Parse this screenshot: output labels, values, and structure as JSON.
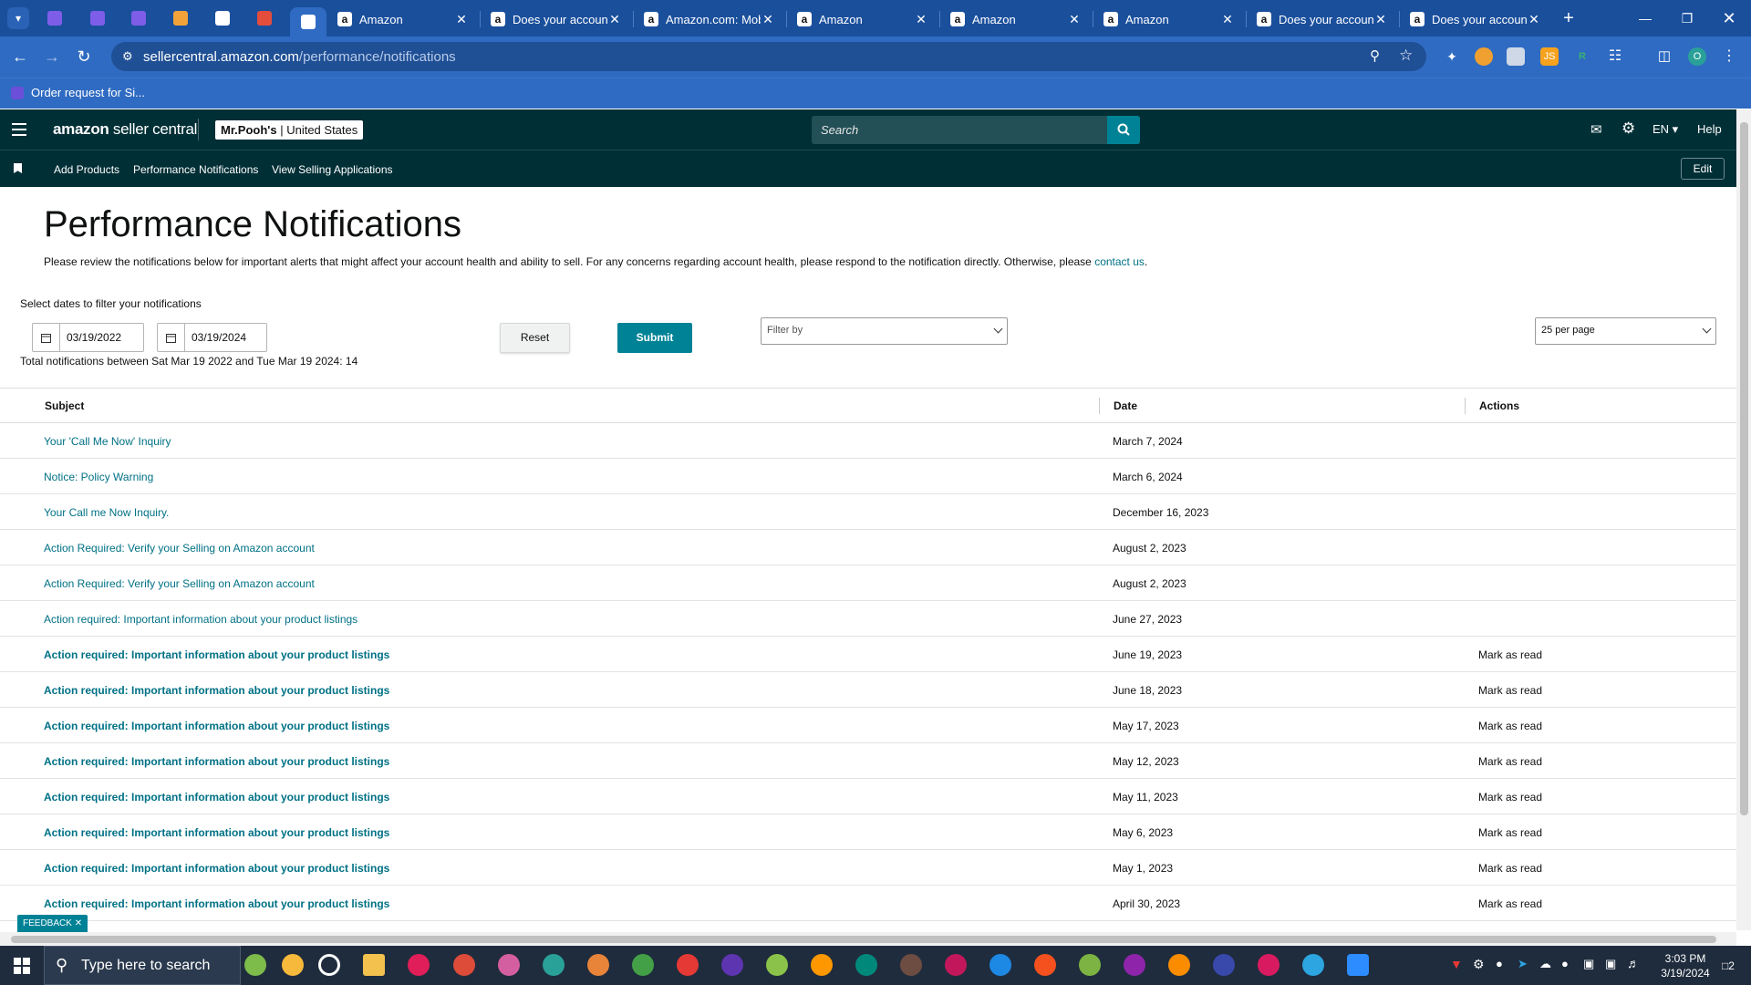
{
  "browser": {
    "tabs": [
      {
        "title": "Amazon",
        "favicon": "a"
      },
      {
        "title": "Does your account",
        "favicon": "a"
      },
      {
        "title": "Amazon.com: Mobile",
        "favicon": "a"
      },
      {
        "title": "Amazon",
        "favicon": "a"
      },
      {
        "title": "Amazon",
        "favicon": "a"
      },
      {
        "title": "Amazon",
        "favicon": "a"
      },
      {
        "title": "Does your account",
        "favicon": "a"
      },
      {
        "title": "Does your account",
        "favicon": "a"
      }
    ],
    "url_domain": "sellercentral.amazon.com",
    "url_path": "/performance/notifications",
    "bookmark": "Order request for Si..."
  },
  "header": {
    "logo_bold": "amazon",
    "logo_rest": " seller central",
    "store_name": "Mr.Pooh's",
    "store_region": " | United States",
    "search_placeholder": "Search",
    "language": "EN",
    "help": "Help"
  },
  "subnav": {
    "items": [
      "Add Products",
      "Performance Notifications",
      "View Selling Applications"
    ],
    "edit": "Edit"
  },
  "page": {
    "title": "Performance Notifications",
    "desc_text": "Please review the notifications below for important alerts that might affect your account health and ability to sell. For any concerns regarding account health, please respond to the notification directly. Otherwise, please ",
    "desc_link": "contact us",
    "desc_end": ".",
    "filter_label": "Select dates to filter your notifications",
    "date_from": "03/19/2022",
    "date_to": "03/19/2024",
    "reset": "Reset",
    "submit": "Submit",
    "filter_by": "Filter by",
    "per_page": "25 per page",
    "total": "Total notifications between Sat Mar 19 2022 and Tue Mar 19 2024: 14"
  },
  "table": {
    "headers": {
      "subject": "Subject",
      "date": "Date",
      "actions": "Actions"
    },
    "rows": [
      {
        "subject": "Your 'Call Me Now' Inquiry",
        "date": "March 7, 2024",
        "action": "",
        "unread": false
      },
      {
        "subject": "Notice: Policy Warning",
        "date": "March 6, 2024",
        "action": "",
        "unread": false
      },
      {
        "subject": "Your Call me Now Inquiry.",
        "date": "December 16, 2023",
        "action": "",
        "unread": false
      },
      {
        "subject": "Action Required: Verify your Selling on Amazon account",
        "date": "August 2, 2023",
        "action": "",
        "unread": false
      },
      {
        "subject": "Action Required: Verify your Selling on Amazon account",
        "date": "August 2, 2023",
        "action": "",
        "unread": false
      },
      {
        "subject": "Action required: Important information about your product listings",
        "date": "June 27, 2023",
        "action": "",
        "unread": false
      },
      {
        "subject": "Action required: Important information about your product listings",
        "date": "June 19, 2023",
        "action": "Mark as read",
        "unread": true
      },
      {
        "subject": "Action required: Important information about your product listings",
        "date": "June 18, 2023",
        "action": "Mark as read",
        "unread": true
      },
      {
        "subject": "Action required: Important information about your product listings",
        "date": "May 17, 2023",
        "action": "Mark as read",
        "unread": true
      },
      {
        "subject": "Action required: Important information about your product listings",
        "date": "May 12, 2023",
        "action": "Mark as read",
        "unread": true
      },
      {
        "subject": "Action required: Important information about your product listings",
        "date": "May 11, 2023",
        "action": "Mark as read",
        "unread": true
      },
      {
        "subject": "Action required: Important information about your product listings",
        "date": "May 6, 2023",
        "action": "Mark as read",
        "unread": true
      },
      {
        "subject": "Action required: Important information about your product listings",
        "date": "May 1, 2023",
        "action": "Mark as read",
        "unread": true
      },
      {
        "subject": "Action required: Important information about your product listings",
        "date": "April 30, 2023",
        "action": "Mark as read",
        "unread": true
      }
    ]
  },
  "feedback": "FEEDBACK",
  "taskbar": {
    "search_placeholder": "Type here to search",
    "time": "3:03 PM",
    "date": "3/19/2024",
    "notif_count": "2"
  },
  "colors": {
    "teal": "#008296",
    "sc_dark": "#002f36",
    "chrome_blue": "#2f6bc2",
    "link": "#007185"
  }
}
